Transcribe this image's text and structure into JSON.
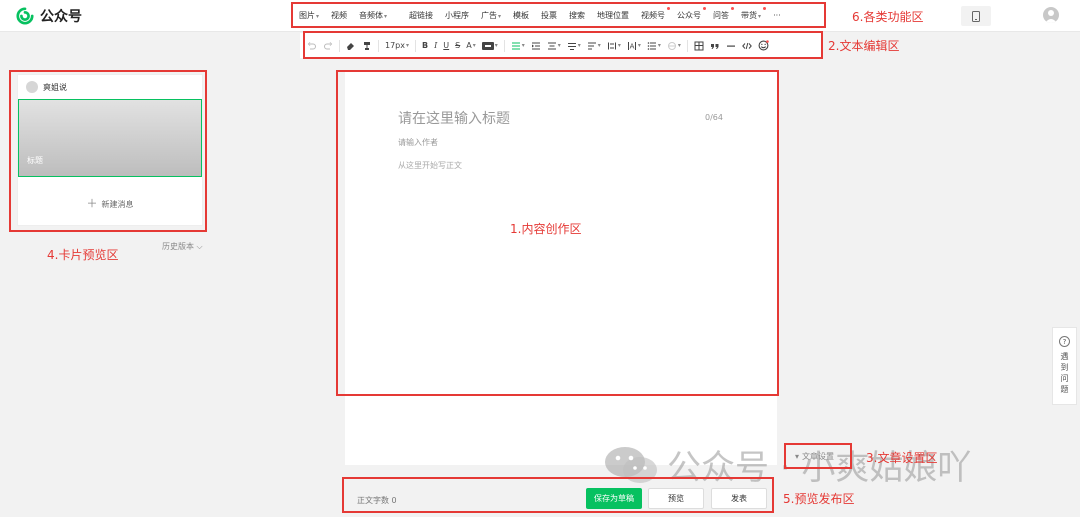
{
  "app": {
    "name": "公众号"
  },
  "func_menu": [
    {
      "label": "图片",
      "caret": true,
      "dot": false
    },
    {
      "label": "视频",
      "caret": false,
      "dot": false
    },
    {
      "label": "音频体",
      "caret": true,
      "dot": false
    },
    {
      "label": "超链接",
      "caret": false,
      "dot": false,
      "gap": true
    },
    {
      "label": "小程序",
      "caret": false,
      "dot": false
    },
    {
      "label": "广告",
      "caret": true,
      "dot": false
    },
    {
      "label": "模板",
      "caret": false,
      "dot": false
    },
    {
      "label": "投票",
      "caret": false,
      "dot": false
    },
    {
      "label": "搜索",
      "caret": false,
      "dot": false
    },
    {
      "label": "地理位置",
      "caret": false,
      "dot": false
    },
    {
      "label": "视频号",
      "caret": false,
      "dot": true
    },
    {
      "label": "公众号",
      "caret": false,
      "dot": true
    },
    {
      "label": "问答",
      "caret": false,
      "dot": true
    },
    {
      "label": "带货",
      "caret": true,
      "dot": true
    },
    {
      "label": "···",
      "caret": false,
      "dot": false
    }
  ],
  "toolbar": {
    "font_size": "17px"
  },
  "card": {
    "author": "爽姐说",
    "cover_title": "标题",
    "new_message": "新建消息"
  },
  "history_label": "历史版本",
  "editor": {
    "title_placeholder": "请在这里输入标题",
    "title_count": "0/64",
    "author_placeholder": "请输入作者",
    "body_placeholder": "从这里开始写正文",
    "settings_label": "文章设置"
  },
  "bottom": {
    "word_count_label": "正文字数",
    "word_count_value": "0",
    "save_label": "保存为草稿",
    "preview_label": "预览",
    "publish_label": "发表"
  },
  "help_float": {
    "chars": [
      "遇",
      "到",
      "问",
      "题"
    ]
  },
  "annotations": {
    "content": "1.内容创作区",
    "text_edit": "2.文本编辑区",
    "settings": "3.文章设置区",
    "card_preview": "4.卡片预览区",
    "publish": "5.预览发布区",
    "functions": "6.各类功能区"
  },
  "watermark": {
    "text": "公众号 · 小爽姑娘吖"
  },
  "colors": {
    "brand": "#07c160",
    "annotation": "#e53935",
    "dot": "#fa5151"
  }
}
